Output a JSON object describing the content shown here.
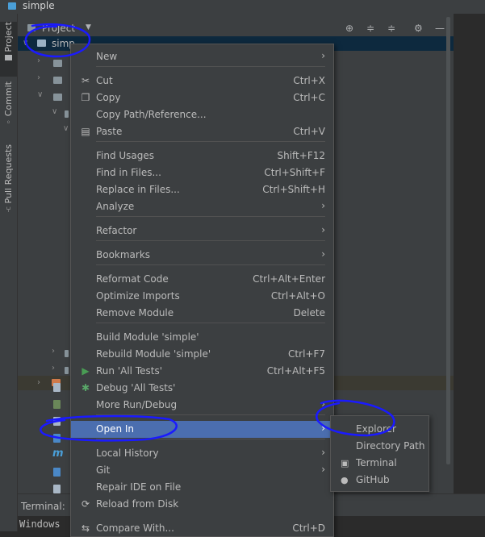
{
  "window": {
    "title": "simple"
  },
  "tool_strip": {
    "tabs": [
      "Project",
      "Commit",
      "Pull Requests"
    ]
  },
  "project_panel": {
    "header_label": "Project",
    "root_item": "simp"
  },
  "terminal": {
    "tab_label": "Terminal:",
    "content": "Windows"
  },
  "context_menu": {
    "items": [
      {
        "label": "New",
        "shortcut": "",
        "submenu": true
      },
      {
        "label": "Cut",
        "shortcut": "Ctrl+X",
        "submenu": false,
        "icon": "scissors-icon"
      },
      {
        "label": "Copy",
        "shortcut": "Ctrl+C",
        "submenu": false,
        "icon": "copy-icon"
      },
      {
        "label": "Copy Path/Reference...",
        "shortcut": "",
        "submenu": false
      },
      {
        "label": "Paste",
        "shortcut": "Ctrl+V",
        "submenu": false,
        "icon": "paste-icon"
      },
      {
        "label": "Find Usages",
        "shortcut": "Shift+F12",
        "submenu": false
      },
      {
        "label": "Find in Files...",
        "shortcut": "Ctrl+Shift+F",
        "submenu": false
      },
      {
        "label": "Replace in Files...",
        "shortcut": "Ctrl+Shift+H",
        "submenu": false
      },
      {
        "label": "Analyze",
        "shortcut": "",
        "submenu": true
      },
      {
        "label": "Refactor",
        "shortcut": "",
        "submenu": true
      },
      {
        "label": "Bookmarks",
        "shortcut": "",
        "submenu": true
      },
      {
        "label": "Reformat Code",
        "shortcut": "Ctrl+Alt+Enter",
        "submenu": false
      },
      {
        "label": "Optimize Imports",
        "shortcut": "Ctrl+Alt+O",
        "submenu": false
      },
      {
        "label": "Remove Module",
        "shortcut": "Delete",
        "submenu": false
      },
      {
        "label": "Build Module 'simple'",
        "shortcut": "",
        "submenu": false
      },
      {
        "label": "Rebuild Module 'simple'",
        "shortcut": "Ctrl+F7",
        "submenu": false
      },
      {
        "label": "Run 'All Tests'",
        "shortcut": "Ctrl+Alt+F5",
        "submenu": false,
        "icon": "run-icon"
      },
      {
        "label": "Debug 'All Tests'",
        "shortcut": "",
        "submenu": false,
        "icon": "debug-icon"
      },
      {
        "label": "More Run/Debug",
        "shortcut": "",
        "submenu": true
      },
      {
        "label": "Open In",
        "shortcut": "",
        "submenu": true,
        "selected": true
      },
      {
        "label": "Local History",
        "shortcut": "",
        "submenu": true
      },
      {
        "label": "Git",
        "shortcut": "",
        "submenu": true
      },
      {
        "label": "Repair IDE on File",
        "shortcut": "",
        "submenu": false
      },
      {
        "label": "Reload from Disk",
        "shortcut": "",
        "submenu": false,
        "icon": "reload-icon"
      },
      {
        "label": "Compare With...",
        "shortcut": "Ctrl+D",
        "submenu": false,
        "icon": "compare-icon"
      }
    ]
  },
  "open_in_submenu": {
    "items": [
      {
        "label": "Explorer",
        "icon": ""
      },
      {
        "label": "Directory Path",
        "icon": ""
      },
      {
        "label": "Terminal",
        "icon": "terminal-icon"
      },
      {
        "label": "GitHub",
        "icon": "github-icon"
      }
    ]
  },
  "colors": {
    "selection": "#4b6eaf",
    "annotation": "#1a1aff",
    "run": "#499c54",
    "debug": "#59a869"
  }
}
